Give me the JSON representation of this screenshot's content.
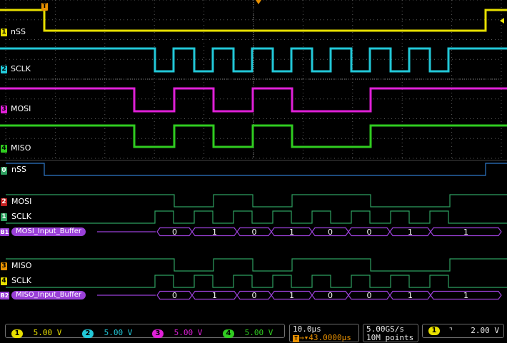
{
  "colors": {
    "ch1": "#e8e000",
    "ch2": "#22c8d8",
    "ch3": "#e020d8",
    "ch4": "#30cc20",
    "digital": "#2ea060",
    "bus": "#9a40d8",
    "grid": "#5a5a5a"
  },
  "analog_channels": [
    {
      "num": "1",
      "label": "nSS"
    },
    {
      "num": "2",
      "label": "SCLK"
    },
    {
      "num": "3",
      "label": "MOSI"
    },
    {
      "num": "4",
      "label": "MISO"
    }
  ],
  "digital_channels": [
    {
      "num": "0",
      "label": "nSS"
    },
    {
      "num": "2",
      "label": "MOSI"
    },
    {
      "num": "1",
      "label": "SCLK"
    },
    {
      "num": "3",
      "label": "MISO"
    },
    {
      "num": "4",
      "label": "SCLK"
    }
  ],
  "buses": [
    {
      "num": "B1",
      "label": "MOSI_Input_Buffer",
      "bits": [
        "0",
        "1",
        "0",
        "1",
        "0",
        "0",
        "1",
        "1"
      ]
    },
    {
      "num": "B2",
      "label": "MISO_Input_Buffer",
      "bits": [
        "0",
        "1",
        "0",
        "1",
        "0",
        "0",
        "1",
        "1"
      ]
    }
  ],
  "trigger_marker": "T",
  "status": {
    "channels": [
      {
        "num": "1",
        "scale": "5.00 V"
      },
      {
        "num": "2",
        "scale": "5.00 V"
      },
      {
        "num": "3",
        "scale": "5.00 V"
      },
      {
        "num": "4",
        "scale": "5.00 V"
      }
    ],
    "timebase": "10.0µs",
    "trigger_pos_icon": "T",
    "trigger_pos_arrow": "→▾",
    "trigger_pos": "43.0000µs",
    "sample_rate": "5.00GS/s",
    "record_length": "10M points",
    "trigger_channel": "1",
    "trigger_slope_icon": "falling-edge-icon",
    "trigger_slope_glyph": "⌝",
    "trigger_level": "2.00 V"
  }
}
